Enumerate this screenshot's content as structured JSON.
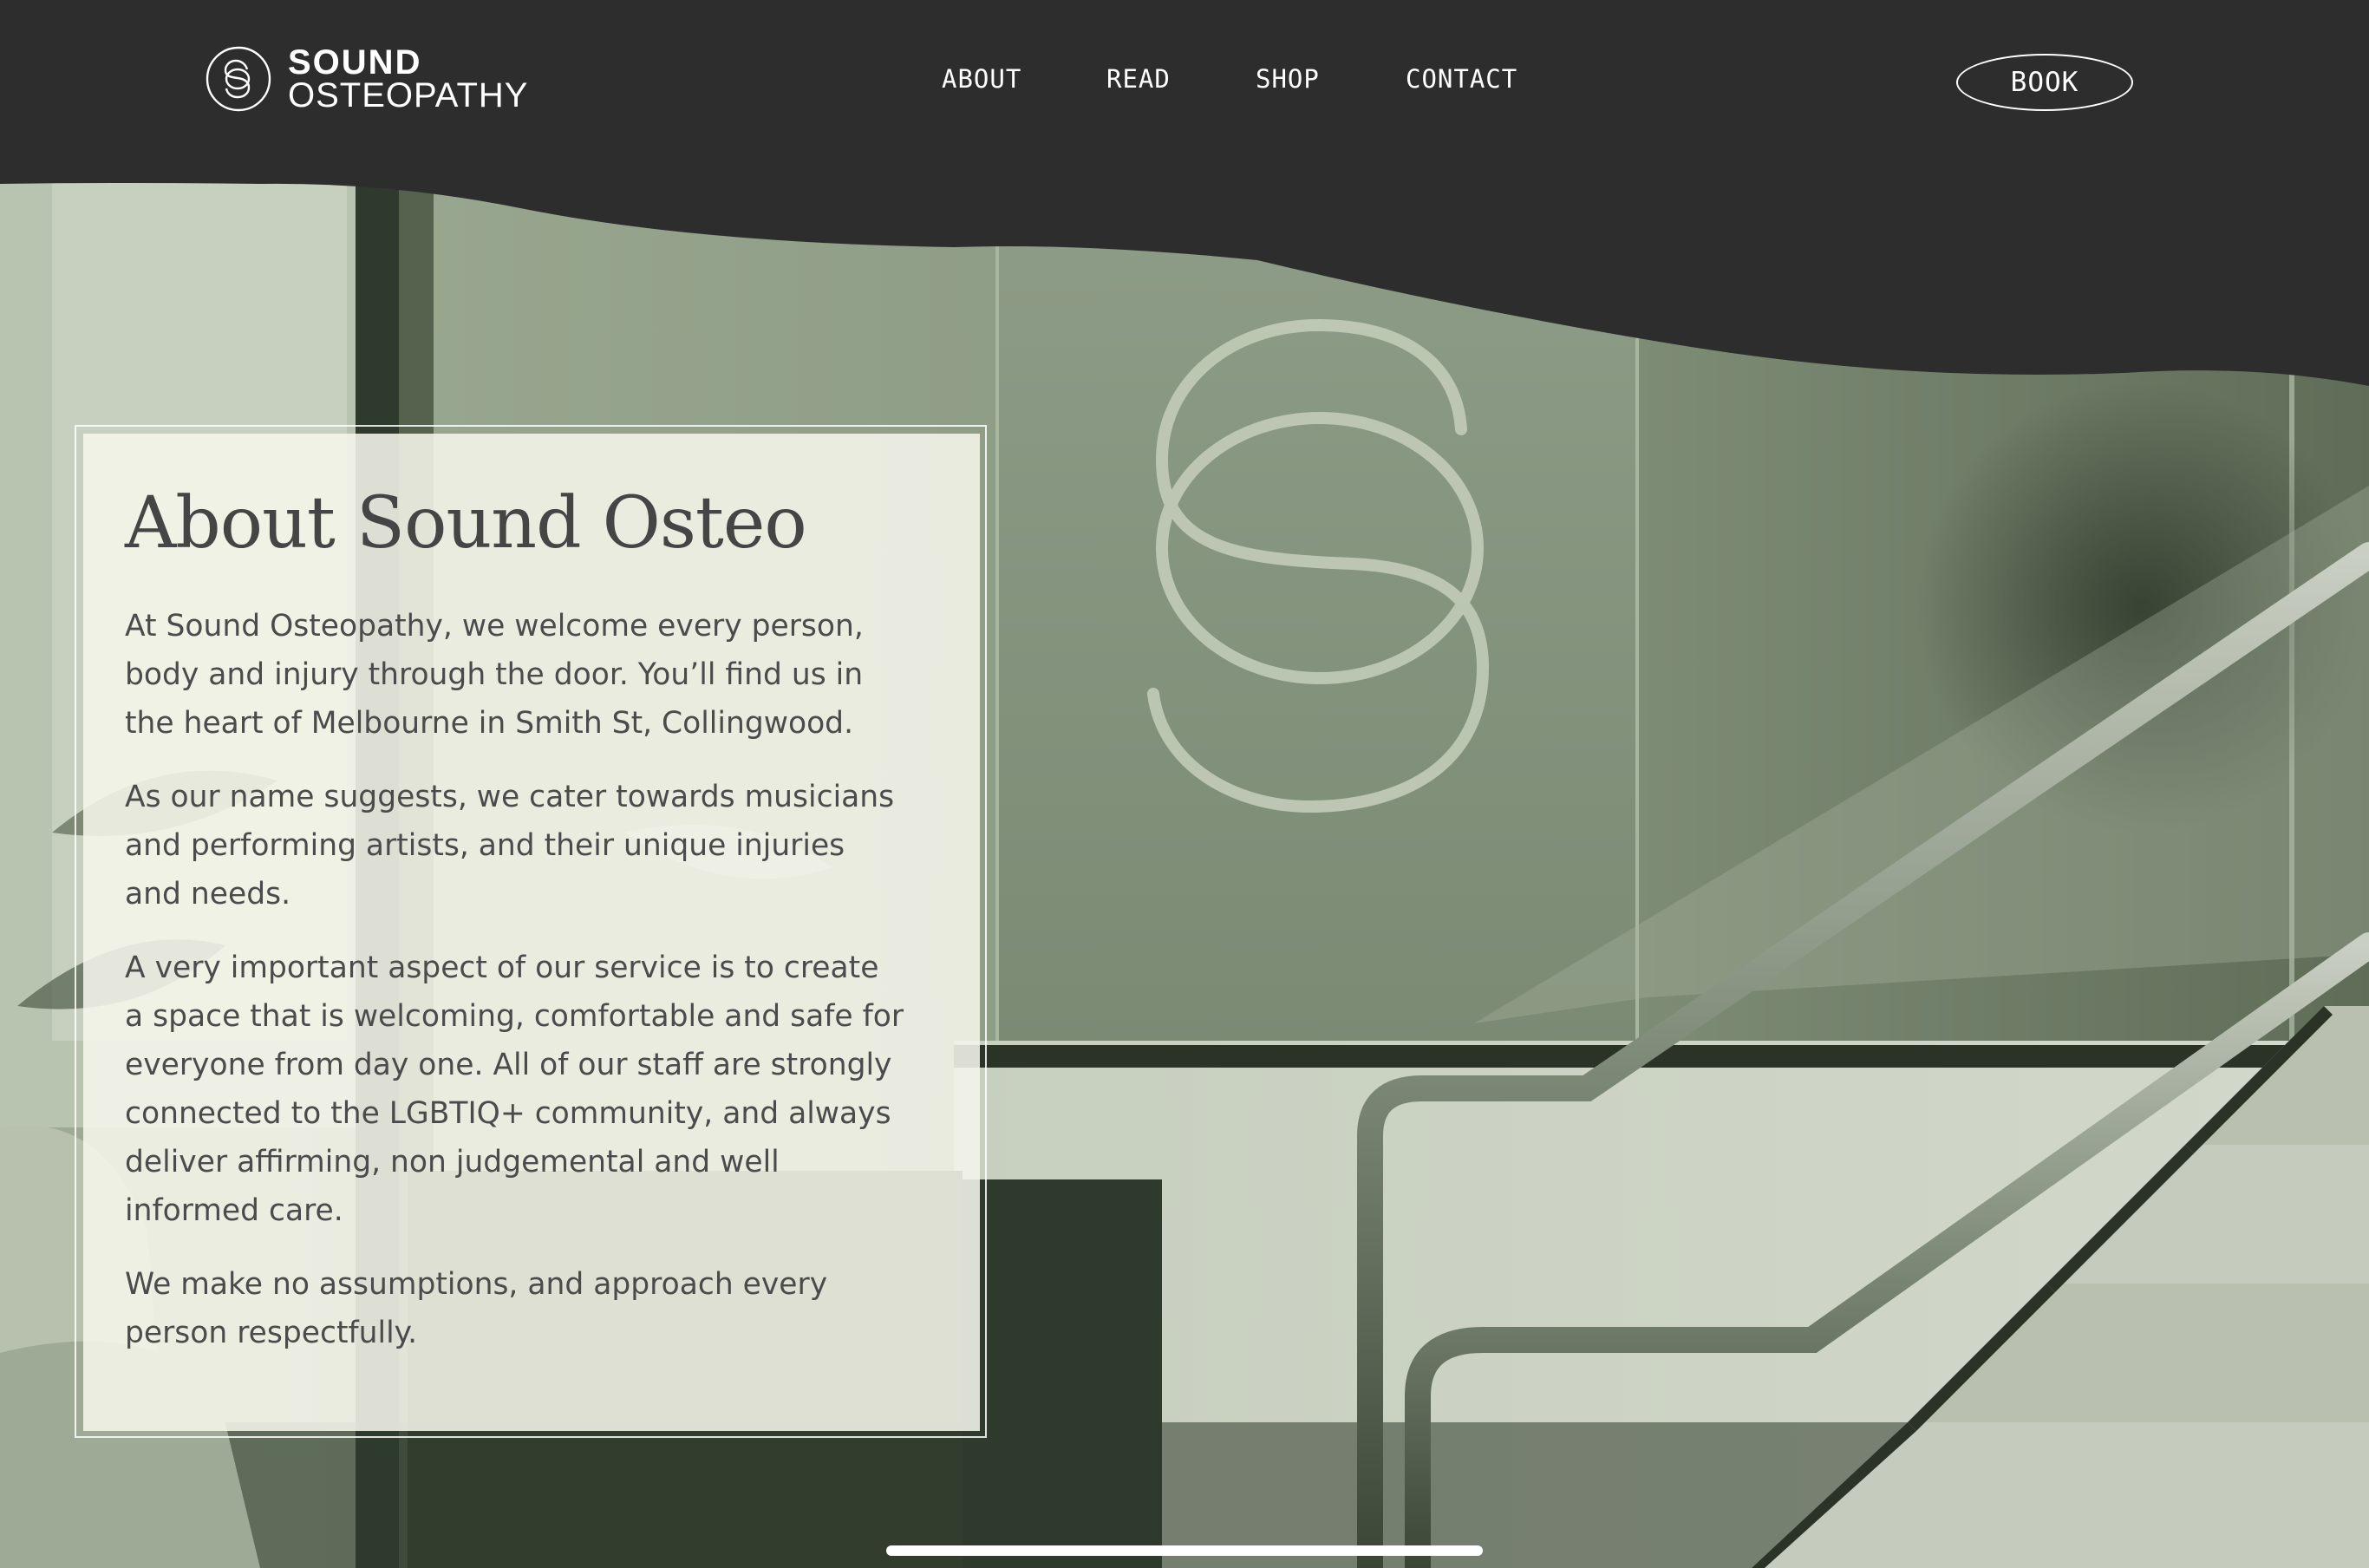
{
  "header": {
    "logo": {
      "line1": "SOUND",
      "line2": "OSTEOPATHY"
    },
    "nav": [
      "ABOUT",
      "READ",
      "SHOP",
      "CONTACT"
    ],
    "book_label": "BOOK"
  },
  "about": {
    "title": "About Sound Osteo",
    "paragraphs": [
      "At Sound Osteopathy, we welcome every person, body and injury through the door. You’ll find us in the heart of Melbourne in Smith St, Collingwood.",
      "As our name suggests, we cater towards musicians and performing artists, and their unique injuries and needs.",
      "A very important aspect of our service is to create a space that is welcoming, comfortable and safe for everyone from day one. All of our staff are strongly connected to the LGBTIQ+ community, and always deliver affirming, non judgemental and well informed care.",
      "We make no assumptions, and approach every person respectfully."
    ]
  },
  "colors": {
    "header_bg": "#2d2d2e",
    "photo_tint": "#8a9a80",
    "card_bg": "#f6f6ec",
    "text": "#4b4b4b"
  }
}
